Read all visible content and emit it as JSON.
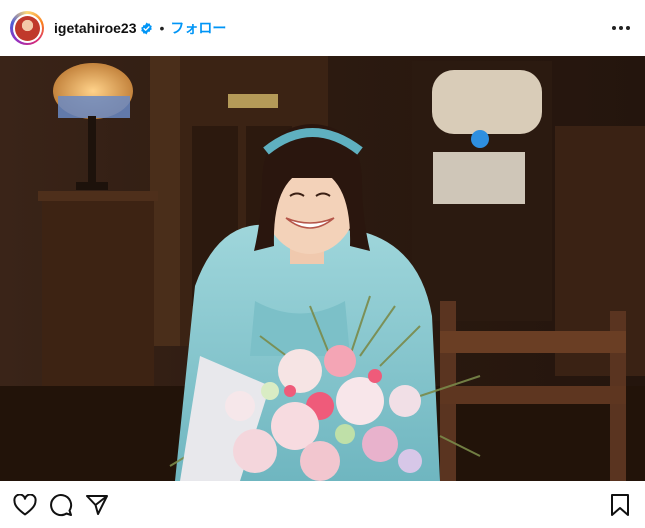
{
  "post": {
    "username": "igetahiroe23",
    "verified": true,
    "separator": "•",
    "follow_label": "フォロー",
    "more_icon": "more-horizontal-icon"
  },
  "actions": {
    "like_icon": "heart-icon",
    "comment_icon": "comment-icon",
    "share_icon": "send-icon",
    "save_icon": "bookmark-icon"
  },
  "colors": {
    "accent": "#0095f6",
    "verified": "#0095f6"
  }
}
